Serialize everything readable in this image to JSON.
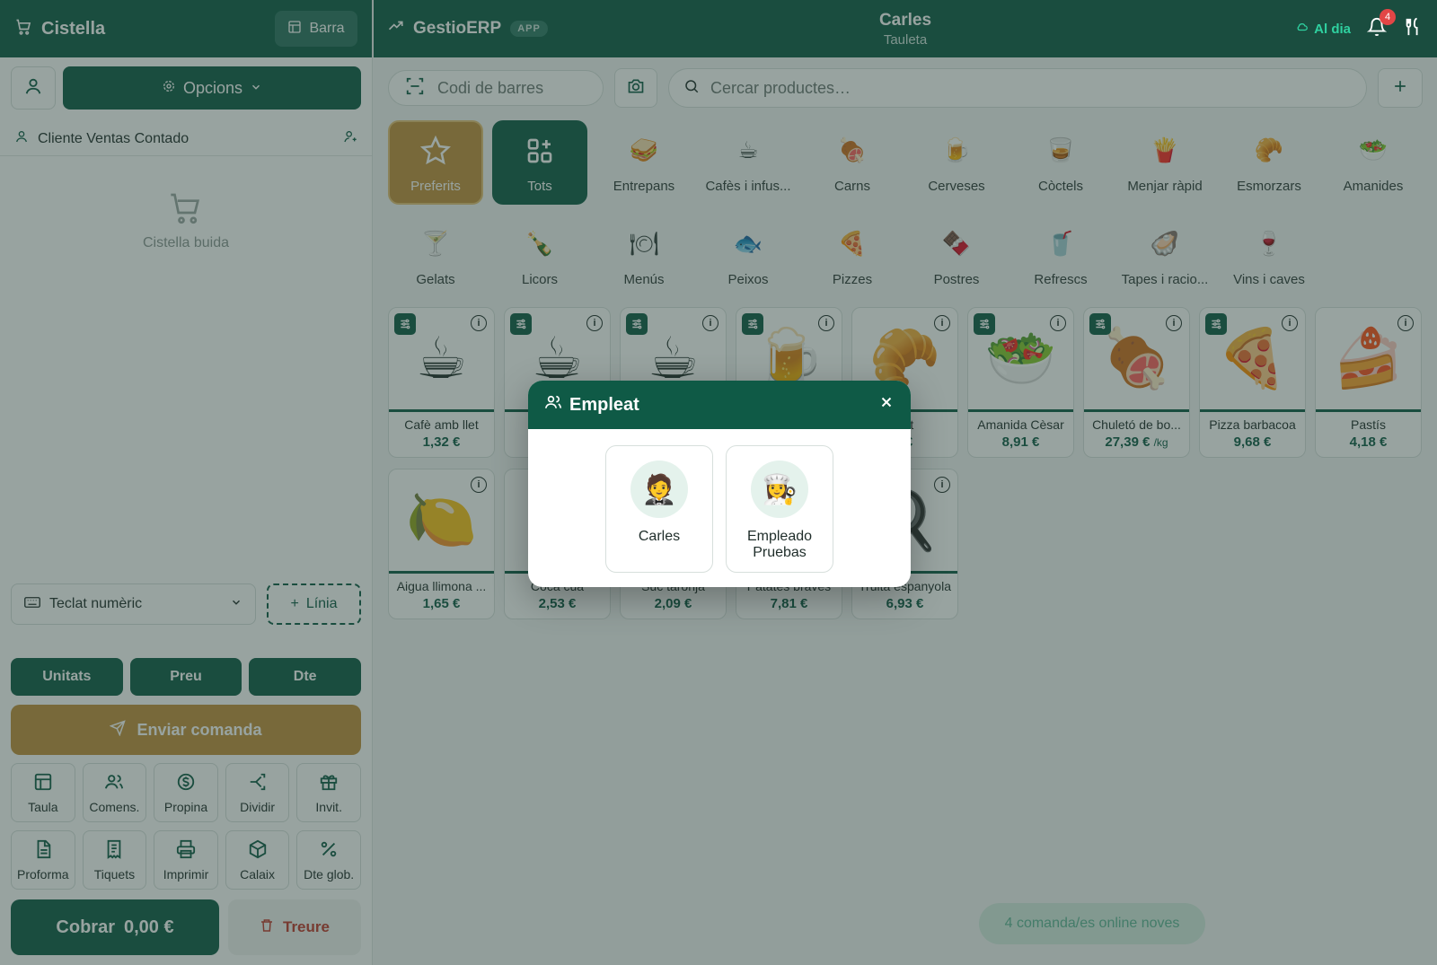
{
  "left": {
    "title": "Cistella",
    "barra_label": "Barra",
    "opcions_label": "Opcions",
    "client": "Cliente Ventas Contado",
    "empty_cart": "Cistella buida",
    "keypad_label": "Teclat numèric",
    "linia_label": "Línia",
    "modes": [
      "Unitats",
      "Preu",
      "Dte"
    ],
    "enviar_label": "Enviar comanda",
    "actions_row1": [
      {
        "label": "Taula",
        "icon": "table-icon"
      },
      {
        "label": "Comens.",
        "icon": "users-icon"
      },
      {
        "label": "Propina",
        "icon": "dollar-icon"
      },
      {
        "label": "Dividir",
        "icon": "split-icon"
      },
      {
        "label": "Invit.",
        "icon": "gift-icon"
      }
    ],
    "actions_row2": [
      {
        "label": "Proforma",
        "icon": "document-icon"
      },
      {
        "label": "Tiquets",
        "icon": "receipt-icon"
      },
      {
        "label": "Imprimir",
        "icon": "printer-icon"
      },
      {
        "label": "Calaix",
        "icon": "box-icon"
      },
      {
        "label": "Dte glob.",
        "icon": "percent-icon"
      }
    ],
    "cobrar_label": "Cobrar",
    "cobrar_total": "0,00 €",
    "treure_label": "Treure"
  },
  "header": {
    "brand": "GestioERP",
    "badge": "APP",
    "user": "Carles",
    "device": "Tauleta",
    "sync": "Al dia",
    "notif_count": "4"
  },
  "search": {
    "barcode_placeholder": "Codi de barres",
    "search_placeholder": "Cercar productes…"
  },
  "categories": [
    {
      "label": "Preferits",
      "style": "fav"
    },
    {
      "label": "Tots",
      "style": "all"
    },
    {
      "label": "Entrepans",
      "emoji": "🥪"
    },
    {
      "label": "Cafès i infus...",
      "emoji": "☕"
    },
    {
      "label": "Carns",
      "emoji": "🍖"
    },
    {
      "label": "Cerveses",
      "emoji": "🍺"
    },
    {
      "label": "Còctels",
      "emoji": "🥃"
    },
    {
      "label": "Menjar ràpid",
      "emoji": "🍟"
    },
    {
      "label": "Esmorzars",
      "emoji": "🥐"
    },
    {
      "label": "Amanides",
      "emoji": "🥗"
    },
    {
      "label": "Gelats",
      "emoji": "🍸"
    },
    {
      "label": "Licors",
      "emoji": "🍾"
    },
    {
      "label": "Menús",
      "emoji": "🍽"
    },
    {
      "label": "Peixos",
      "emoji": "🐟"
    },
    {
      "label": "Pizzes",
      "emoji": "🍕"
    },
    {
      "label": "Postres",
      "emoji": "🍫"
    },
    {
      "label": "Refrescs",
      "emoji": "🥤"
    },
    {
      "label": "Tapes i racio...",
      "emoji": "🦪"
    },
    {
      "label": "Vins i caves",
      "emoji": "🍷"
    }
  ],
  "products": [
    {
      "name": "Cafè amb llet",
      "price": "1,32 €",
      "unit": "",
      "emoji": "☕",
      "opt": true
    },
    {
      "name": "",
      "price": "",
      "unit": "",
      "emoji": "☕",
      "opt": true
    },
    {
      "name": "",
      "price": "",
      "unit": "",
      "emoji": "☕",
      "opt": true
    },
    {
      "name": "",
      "price": "",
      "unit": "",
      "emoji": "🍺",
      "opt": true
    },
    {
      "name": "ant",
      "price": ") €",
      "unit": "",
      "emoji": "🥐",
      "opt": false
    },
    {
      "name": "Amanida Cèsar",
      "price": "8,91 €",
      "unit": "",
      "emoji": "🥗",
      "opt": true
    },
    {
      "name": "Chuletó de bo...",
      "price": "27,39 €",
      "unit": "/kg",
      "emoji": "🍖",
      "opt": true
    },
    {
      "name": "Pizza barbacoa",
      "price": "9,68 €",
      "unit": "",
      "emoji": "🍕",
      "opt": true
    },
    {
      "name": "Pastís",
      "price": "4,18 €",
      "unit": "",
      "emoji": "🍰",
      "opt": false
    },
    {
      "name": "Aigua llimona ...",
      "price": "1,65 €",
      "unit": "",
      "emoji": "🍋",
      "opt": false
    },
    {
      "name": "Coca cua",
      "price": "2,53 €",
      "unit": "",
      "emoji": "🥤",
      "opt": false
    },
    {
      "name": "Suc taronja",
      "price": "2,09 €",
      "unit": "",
      "emoji": "🍊",
      "opt": false
    },
    {
      "name": "Patates braves",
      "price": "7,81 €",
      "unit": "",
      "emoji": "🍟",
      "opt": false
    },
    {
      "name": "Truita espanyola",
      "price": "6,93 €",
      "unit": "",
      "emoji": "🍳",
      "opt": false
    }
  ],
  "online_orders": "4 comanda/es online noves",
  "modal": {
    "title": "Empleat",
    "employees": [
      {
        "name": "Carles",
        "emoji": "🤵"
      },
      {
        "name": "Empleado Pruebas",
        "emoji": "👩‍🍳"
      }
    ]
  },
  "colors": {
    "primary": "#0f5a46",
    "accent": "#c2913c",
    "danger": "#c0392b",
    "sync": "#2fd1a0"
  }
}
